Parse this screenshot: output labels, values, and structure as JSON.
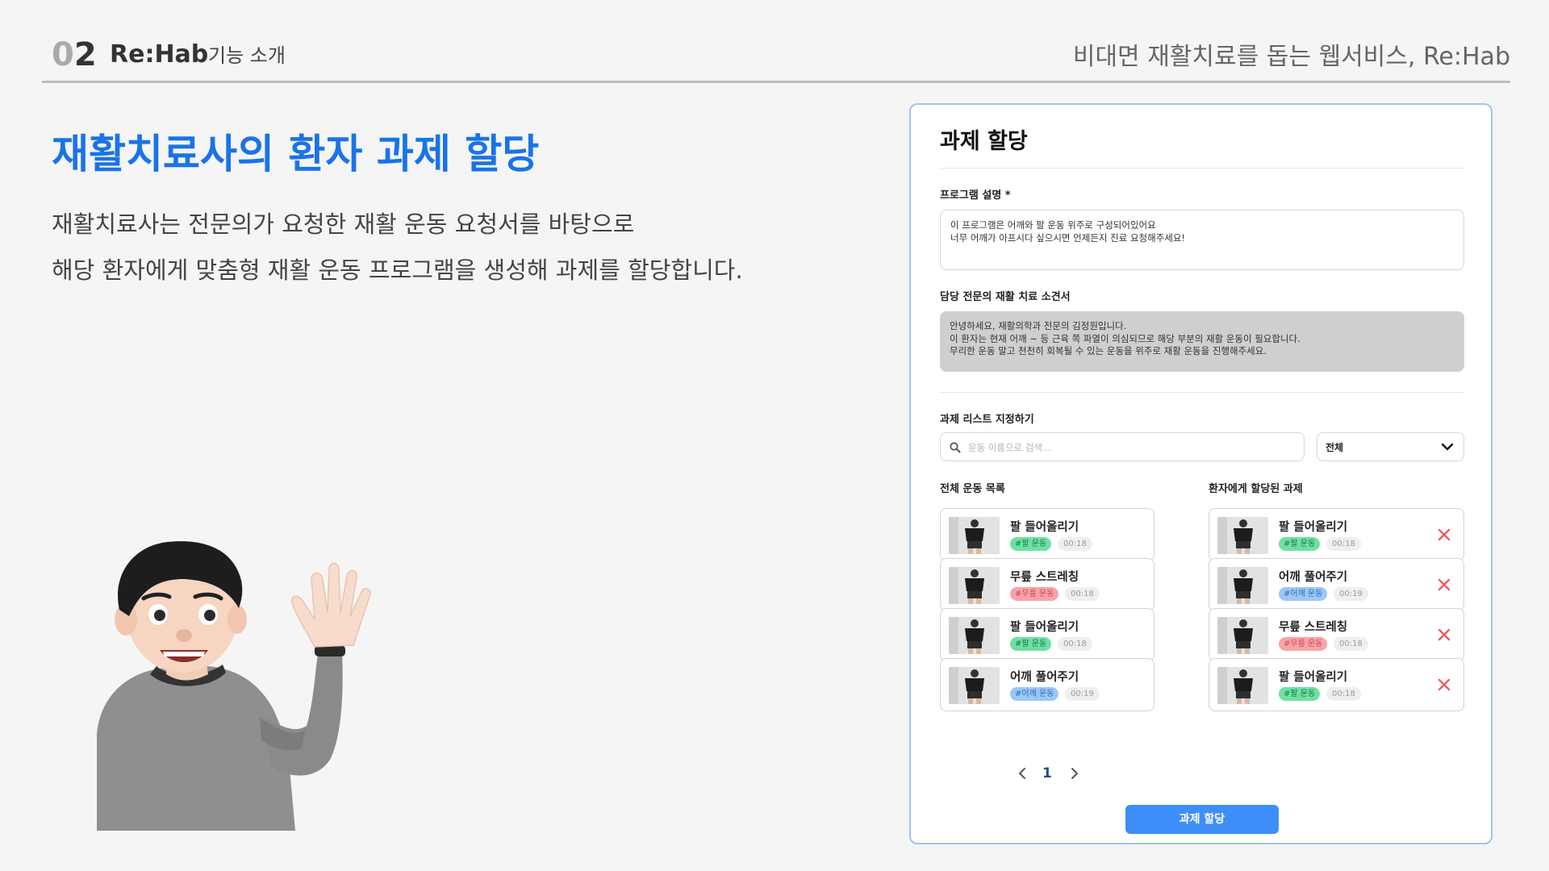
{
  "header": {
    "num_faded": "0",
    "num_strong": "2",
    "brand": "Re:Hab",
    "section": "기능 소개",
    "tagline": "비대면 재활치료를 돕는 웹서비스, Re:Hab"
  },
  "slide": {
    "title": "재활치료사의 환자 과제 할당",
    "desc_line1": "재활치료사는 전문의가 요청한 재활 운동 요청서를 바탕으로",
    "desc_line2": "해당 환자에게 맞춤형 재활 운동 프로그램을 생성해 과제를 할당합니다."
  },
  "panel": {
    "title": "과제 할당",
    "program_label": "프로그램 설명 *",
    "program_line1": "이 프로그램은 어깨와 팔 운동 위주로 구성되어있어요",
    "program_line2": "너무 어깨가 아프시다 싶으시면 언제든지 진료 요청해주세요!",
    "opinion_label": "담당 전문의 재활 치료 소견서",
    "opinion_line1": "안녕하세요, 재활의학과 전문의 김정원입니다.",
    "opinion_line2": "이 환자는 현재 어깨 ~ 등 근육 쪽 파열이 의심되므로 해당 부분의 재활 운동이 필요합니다.",
    "opinion_line3": "무리한 운동 말고 천천히 회복될 수 있는 운동을 위주로 재활 운동을 진행해주세요.",
    "task_label": "과제 리스트 지정하기",
    "search_placeholder": "운동 이름으로 검색...",
    "filter_value": "전체",
    "all_list_label": "전체 운동 목록",
    "assigned_list_label": "환자에게 할당된 과제",
    "all_exercises": [
      {
        "name": "팔 들어올리기",
        "tag": "#팔 운동",
        "duration": "00:18"
      },
      {
        "name": "무릎 스트레칭",
        "tag": "#무릎 운동",
        "duration": "00:18"
      },
      {
        "name": "팔 들어올리기",
        "tag": "#팔 운동",
        "duration": "00:18"
      },
      {
        "name": "어깨 풀어주기",
        "tag": "#어깨 운동",
        "duration": "00:19"
      }
    ],
    "assigned_exercises": [
      {
        "name": "팔 들어올리기",
        "tag": "#팔 운동",
        "duration": "00:18"
      },
      {
        "name": "어깨 풀어주기",
        "tag": "#어깨 운동",
        "duration": "00:19"
      },
      {
        "name": "무릎 스트레칭",
        "tag": "#무릎 운동",
        "duration": "00:18"
      },
      {
        "name": "팔 들어올리기",
        "tag": "#팔 운동",
        "duration": "00:18"
      }
    ],
    "current_page": "1",
    "assign_button": "과제 할당"
  },
  "colors": {
    "title_blue": "#1a73e8",
    "arm_tag_bg": "#6ee0a4",
    "knee_tag_bg": "#f9a3a8",
    "shoulder_tag_bg": "#9cc7f6",
    "remove_red": "#f25a5a",
    "button_blue": "#3d8ef8"
  },
  "icons": {
    "search": "search-icon",
    "dropdown": "chevron-down-icon",
    "remove": "close-icon",
    "prev": "chevron-left-icon",
    "next": "chevron-right-icon"
  }
}
